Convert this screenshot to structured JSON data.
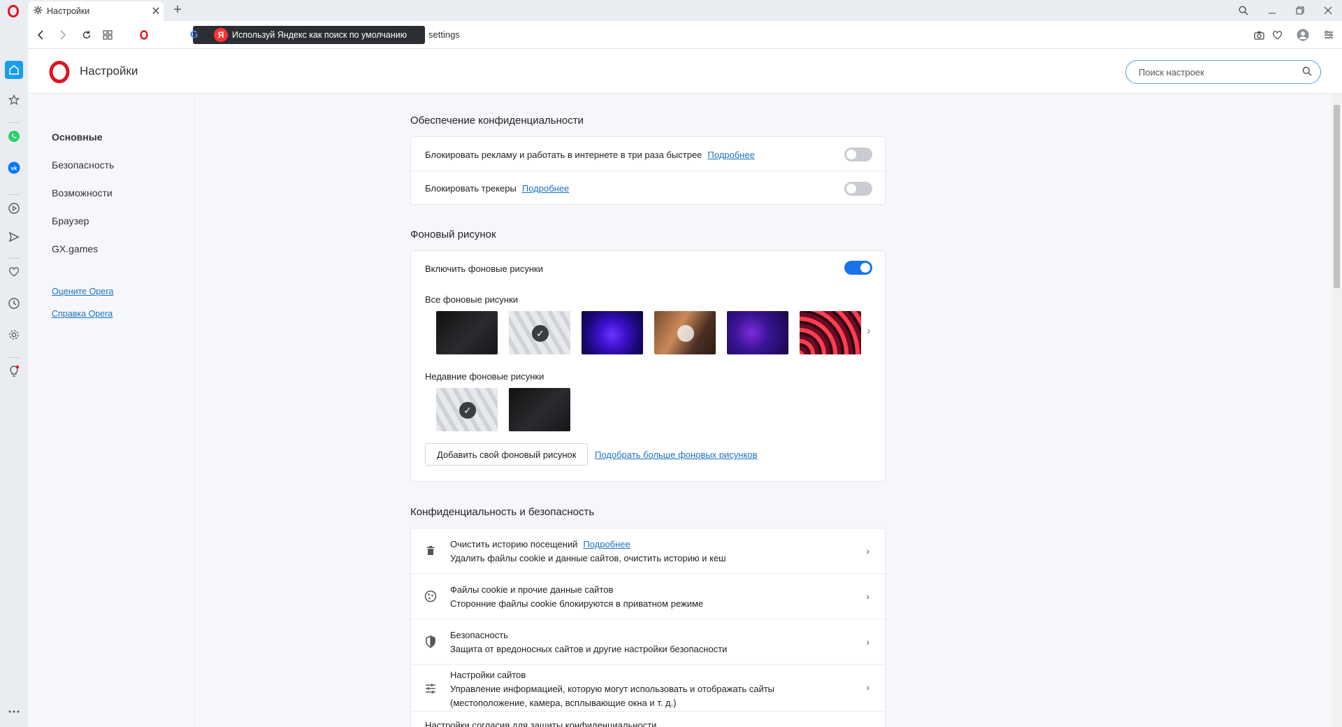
{
  "tab": {
    "title": "Настройки"
  },
  "addressbar": {
    "yandex_tooltip": "Используй Яндекс как поиск по умолчанию",
    "url": "settings"
  },
  "header": {
    "title": "Настройки",
    "search_placeholder": "Поиск настроек"
  },
  "nav": {
    "items": [
      "Основные",
      "Безопасность",
      "Возможности",
      "Браузер",
      "GX.games"
    ],
    "active": "Основные",
    "links": [
      "Оцените Opera",
      "Справка Opera"
    ]
  },
  "privacy_block": {
    "title": "Обеспечение конфиденциальности",
    "rows": [
      {
        "label": "Блокировать рекламу и работать в интернете в три раза быстрее",
        "link": "Подробнее",
        "enabled": false
      },
      {
        "label": "Блокировать трекеры",
        "link": "Подробнее",
        "enabled": false
      }
    ]
  },
  "wallpaper": {
    "title": "Фоновый рисунок",
    "enable_label": "Включить фоновые рисунки",
    "enabled": true,
    "all_label": "Все фоновые рисунки",
    "recent_label": "Недавние фоновые рисунки",
    "add_button": "Добавить свой фоновый рисунок",
    "more_link": "Подобрать больше фоновых рисунков"
  },
  "privacy_security": {
    "title": "Конфиденциальность и безопасность",
    "rows": [
      {
        "title": "Очистить историю посещений",
        "link": "Подробнее",
        "sub": "Удалить файлы cookie и данные сайтов, очистить историю и кеш",
        "icon": "trash-icon"
      },
      {
        "title": "Файлы cookie и прочие данные сайтов",
        "sub": "Сторонние файлы cookie блокируются в приватном режиме",
        "icon": "cookie-icon"
      },
      {
        "title": "Безопасность",
        "sub": "Защита от вредоносных сайтов и другие настройки безопасности",
        "icon": "shield-icon"
      },
      {
        "title": "Настройки сайтов",
        "sub": "Управление информацией, которую могут использовать и отображать сайты",
        "sub2": "(местоположение, камера, всплывающие окна и т. д.)",
        "icon": "sliders-icon"
      },
      {
        "title": "Настройки согласия для защиты конфиденциальности"
      }
    ]
  },
  "colors": {
    "accent": "#1a73e8",
    "link": "#1a73c2",
    "opera_red": "#e0141e"
  }
}
